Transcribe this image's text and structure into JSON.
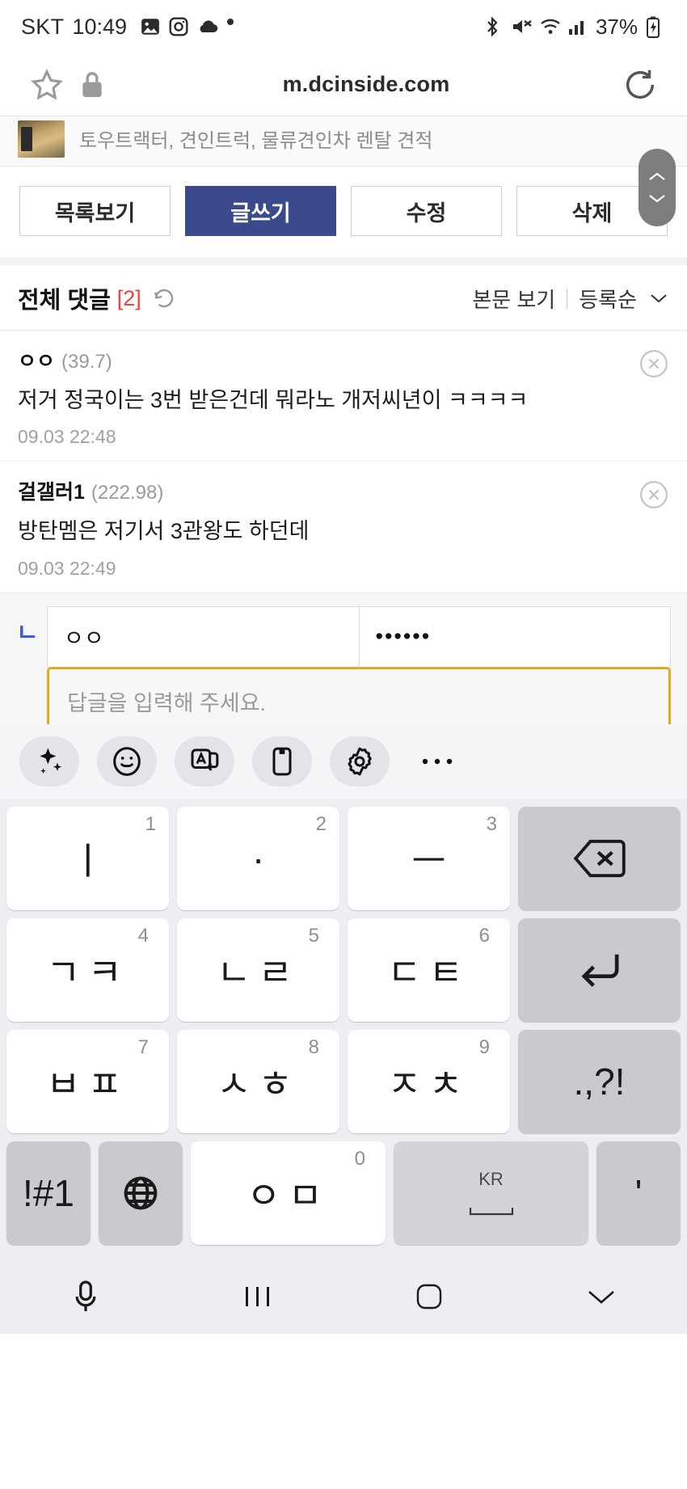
{
  "status_bar": {
    "carrier": "SKT",
    "time": "10:49",
    "battery": "37%",
    "icons": [
      "photo-icon",
      "instagram-icon",
      "cloud-icon",
      "dot-icon"
    ],
    "right_icons": [
      "bluetooth-icon",
      "mute-icon",
      "wifi-icon",
      "signal-icon",
      "battery-charging-icon"
    ]
  },
  "browser": {
    "url": "m.dcinside.com",
    "star_icon": "bookmark-star-icon",
    "lock_icon": "lock-icon",
    "reload_icon": "reload-icon"
  },
  "ad": {
    "text": "토우트랙터, 견인트럭, 물류견인차 렌탈 견적"
  },
  "action_buttons": [
    {
      "label": "목록보기",
      "primary": false
    },
    {
      "label": "글쓰기",
      "primary": true
    },
    {
      "label": "수정",
      "primary": false
    },
    {
      "label": "삭제",
      "primary": false
    }
  ],
  "comments_header": {
    "title": "전체 댓글",
    "count": "[2]",
    "refresh_icon": "refresh-icon",
    "view_post": "본문 보기",
    "sort": "등록순",
    "sort_chevron": "chevron-down-icon"
  },
  "comments": [
    {
      "author": "ㅇㅇ",
      "author_suffix": "",
      "ip": "(39.7)",
      "body": "저거 정국이는 3번 받은건데 뭐라노 개저씨년이 ㅋㅋㅋㅋ",
      "date": "09.03 22:48",
      "close_icon": "close-circle-icon"
    },
    {
      "author": "걸갤러",
      "author_suffix": "1",
      "ip": "(222.98)",
      "body": "방탄멤은 저기서 3관왕도 하던데",
      "date": "09.03 22:49",
      "close_icon": "close-circle-icon"
    }
  ],
  "reply_form": {
    "marker": "ㄴ",
    "nickname_value": "ㅇㅇ",
    "password_value": "••••••",
    "textarea_placeholder": "답글을 입력해 주세요."
  },
  "scroll_widget": {
    "up_icon": "chevron-up-icon",
    "down_icon": "chevron-down-icon"
  },
  "keyboard": {
    "toolbar": [
      {
        "icon": "sparkle-ai-icon"
      },
      {
        "icon": "emoji-smiley-icon"
      },
      {
        "icon": "translate-icon"
      },
      {
        "icon": "clipboard-icon"
      },
      {
        "icon": "settings-gear-icon"
      },
      {
        "icon": "more-dots-icon"
      }
    ],
    "rows": [
      [
        {
          "label": "ㅣ",
          "num": "1",
          "type": "char"
        },
        {
          "label": "·",
          "num": "2",
          "type": "char"
        },
        {
          "label": "ㅡ",
          "num": "3",
          "type": "char"
        },
        {
          "label": "",
          "num": "",
          "type": "backspace",
          "icon": "backspace-icon"
        }
      ],
      [
        {
          "label": "ㄱㅋ",
          "num": "4",
          "type": "char"
        },
        {
          "label": "ㄴㄹ",
          "num": "5",
          "type": "char"
        },
        {
          "label": "ㄷㅌ",
          "num": "6",
          "type": "char"
        },
        {
          "label": "",
          "num": "",
          "type": "enter",
          "icon": "enter-icon"
        }
      ],
      [
        {
          "label": "ㅂㅍ",
          "num": "7",
          "type": "char"
        },
        {
          "label": "ㅅㅎ",
          "num": "8",
          "type": "char"
        },
        {
          "label": "ㅈㅊ",
          "num": "9",
          "type": "char"
        },
        {
          "label": ".,?!",
          "num": "",
          "type": "punct"
        }
      ],
      [
        {
          "label": "!#1",
          "num": "",
          "type": "symbols"
        },
        {
          "label": "",
          "num": "",
          "type": "globe",
          "icon": "globe-icon"
        },
        {
          "label": "ㅇㅁ",
          "num": "0",
          "type": "char"
        },
        {
          "label": "KR",
          "num": "",
          "type": "space"
        },
        {
          "label": "'",
          "num": "",
          "type": "punct"
        }
      ]
    ]
  },
  "nav_bar": {
    "mic_icon": "microphone-icon",
    "recents_icon": "recents-icon",
    "home_icon": "home-icon",
    "collapse_icon": "chevron-down-icon"
  }
}
